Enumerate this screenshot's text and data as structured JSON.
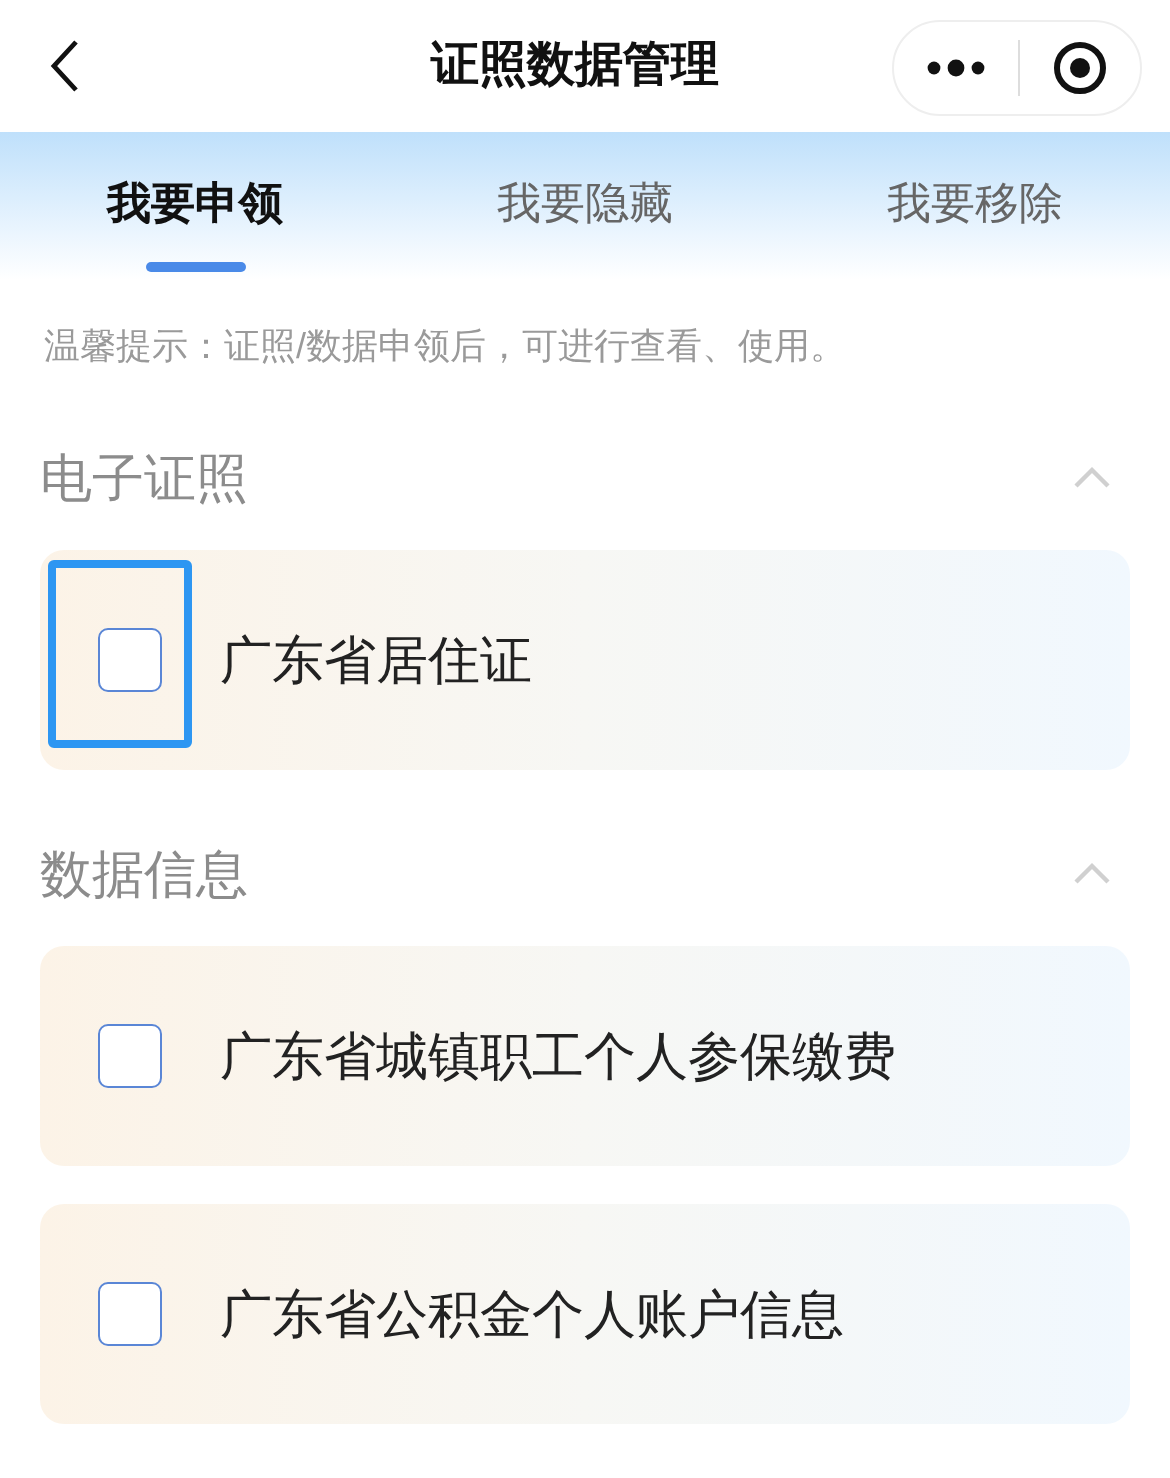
{
  "nav_bar": {
    "title": "证照数据管理"
  },
  "tabs": [
    {
      "label": "我要申领",
      "selected": true
    },
    {
      "label": "我要隐藏",
      "selected": false
    },
    {
      "label": "我要移除",
      "selected": false
    }
  ],
  "tip": "温馨提示：证照/数据申领后，可进行查看、使用。",
  "sections": [
    {
      "title": "电子证照",
      "expanded": true,
      "items": [
        {
          "label": "广东省居住证",
          "checked": false,
          "focused": true
        }
      ]
    },
    {
      "title": "数据信息",
      "expanded": true,
      "items": [
        {
          "label": "广东省城镇职工个人参保缴费",
          "checked": false,
          "focused": false
        },
        {
          "label": "广东省公积金个人账户信息",
          "checked": false,
          "focused": false
        }
      ]
    }
  ]
}
